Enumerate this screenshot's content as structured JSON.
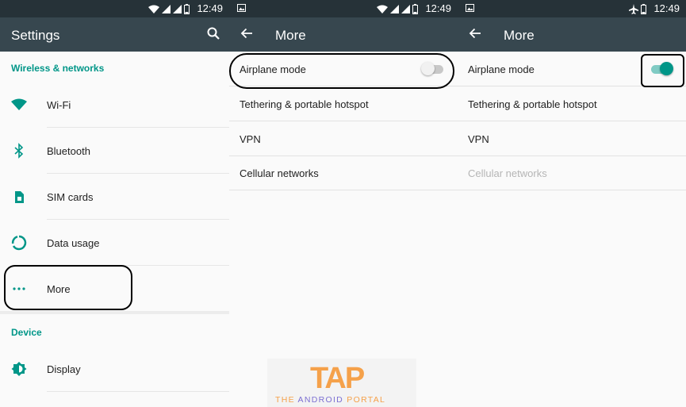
{
  "status": {
    "time": "12:49"
  },
  "settings": {
    "title": "Settings",
    "section_wireless": "Wireless & networks",
    "items": [
      {
        "label": "Wi-Fi",
        "icon": "wifi-icon"
      },
      {
        "label": "Bluetooth",
        "icon": "bluetooth-icon"
      },
      {
        "label": "SIM cards",
        "icon": "sim-card-icon"
      },
      {
        "label": "Data usage",
        "icon": "data-usage-icon"
      },
      {
        "label": "More",
        "icon": "more-dots-icon"
      }
    ],
    "section_device": "Device",
    "device_items": [
      {
        "label": "Display",
        "icon": "display-brightness-icon"
      }
    ]
  },
  "more_before": {
    "title": "More",
    "items": [
      {
        "label": "Airplane mode",
        "toggle": "off"
      },
      {
        "label": "Tethering & portable hotspot"
      },
      {
        "label": "VPN"
      },
      {
        "label": "Cellular networks"
      }
    ]
  },
  "more_after": {
    "title": "More",
    "items": [
      {
        "label": "Airplane mode",
        "toggle": "on"
      },
      {
        "label": "Tethering & portable hotspot"
      },
      {
        "label": "VPN"
      },
      {
        "label": "Cellular networks",
        "disabled": true
      }
    ]
  },
  "watermark": {
    "logo": "TAP",
    "tagline_the": "THE ",
    "tagline_android": "ANDROID ",
    "tagline_portal": "PORTAL"
  },
  "colors": {
    "statusbar": "#263238",
    "toolbar": "#37474f",
    "accent": "#009688"
  }
}
